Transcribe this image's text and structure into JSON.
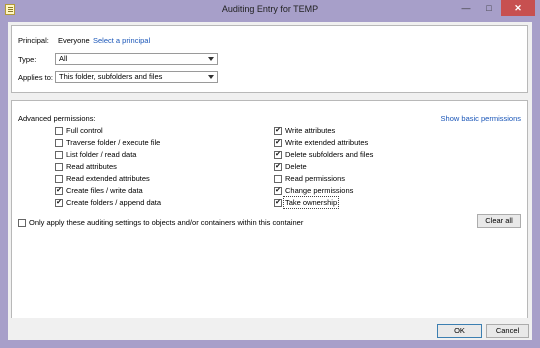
{
  "window": {
    "title": "Auditing Entry for TEMP"
  },
  "principal": {
    "label": "Principal:",
    "value": "Everyone",
    "link": "Select a principal"
  },
  "type": {
    "label": "Type:",
    "value": "All"
  },
  "applies_to": {
    "label": "Applies to:",
    "value": "This folder, subfolders and files"
  },
  "advanced": {
    "header": "Advanced permissions:",
    "show_basic_link": "Show basic permissions",
    "left": [
      {
        "label": "Full control",
        "checked": false
      },
      {
        "label": "Traverse folder / execute file",
        "checked": false
      },
      {
        "label": "List folder / read data",
        "checked": false
      },
      {
        "label": "Read attributes",
        "checked": false
      },
      {
        "label": "Read extended attributes",
        "checked": false
      },
      {
        "label": "Create files / write data",
        "checked": true
      },
      {
        "label": "Create folders / append data",
        "checked": true
      }
    ],
    "right": [
      {
        "label": "Write attributes",
        "checked": true
      },
      {
        "label": "Write extended attributes",
        "checked": true
      },
      {
        "label": "Delete subfolders and files",
        "checked": true
      },
      {
        "label": "Delete",
        "checked": true
      },
      {
        "label": "Read permissions",
        "checked": false
      },
      {
        "label": "Change permissions",
        "checked": true
      },
      {
        "label": "Take ownership",
        "checked": true
      }
    ],
    "only_apply": {
      "label": "Only apply these auditing settings to objects and/or containers within this container",
      "checked": false
    },
    "clear_all": "Clear all"
  },
  "buttons": {
    "ok": "OK",
    "cancel": "Cancel"
  }
}
